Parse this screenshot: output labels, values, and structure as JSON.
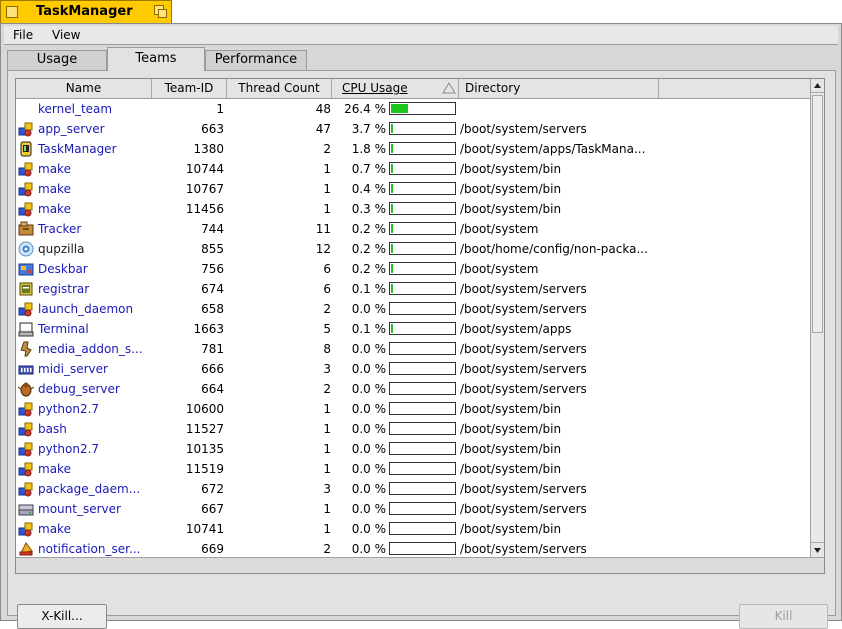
{
  "window": {
    "title": "TaskManager"
  },
  "menu": [
    "File",
    "View"
  ],
  "tabs": [
    {
      "label": "Usage",
      "active": false
    },
    {
      "label": "Teams",
      "active": true
    },
    {
      "label": "Performance",
      "active": false
    }
  ],
  "columns": {
    "name": "Name",
    "team_id": "Team-ID",
    "thread_count": "Thread Count",
    "cpu_usage": "CPU Usage",
    "directory": "Directory"
  },
  "sort": {
    "column": "cpu_usage",
    "direction": "descending"
  },
  "colors": {
    "title_tab": "#ffcb00",
    "cpu_bar": "#1fc41f",
    "link_text": "#1a1ab8"
  },
  "rows": [
    {
      "icon": "none",
      "name": "kernel_team",
      "team_id": "1",
      "threads": "48",
      "cpu": "26.4 %",
      "cpu_fraction": 0.264,
      "dir": ""
    },
    {
      "icon": "app-generic-icon",
      "name": "app_server",
      "team_id": "663",
      "threads": "47",
      "cpu": "3.7 %",
      "cpu_fraction": 0.037,
      "dir": "/boot/system/servers"
    },
    {
      "icon": "taskmanager-icon",
      "name": "TaskManager",
      "team_id": "1380",
      "threads": "2",
      "cpu": "1.8 %",
      "cpu_fraction": 0.018,
      "dir": "/boot/system/apps/TaskMana..."
    },
    {
      "icon": "app-generic-icon",
      "name": "make",
      "team_id": "10744",
      "threads": "1",
      "cpu": "0.7 %",
      "cpu_fraction": 0.007,
      "dir": "/boot/system/bin"
    },
    {
      "icon": "app-generic-icon",
      "name": "make",
      "team_id": "10767",
      "threads": "1",
      "cpu": "0.4 %",
      "cpu_fraction": 0.004,
      "dir": "/boot/system/bin"
    },
    {
      "icon": "app-generic-icon",
      "name": "make",
      "team_id": "11456",
      "threads": "1",
      "cpu": "0.3 %",
      "cpu_fraction": 0.003,
      "dir": "/boot/system/bin"
    },
    {
      "icon": "tracker-icon",
      "name": "Tracker",
      "team_id": "744",
      "threads": "11",
      "cpu": "0.2 %",
      "cpu_fraction": 0.002,
      "dir": "/boot/system"
    },
    {
      "icon": "qupzilla-icon",
      "name": "qupzilla",
      "team_id": "855",
      "threads": "12",
      "cpu": "0.2 %",
      "cpu_fraction": 0.002,
      "dir": "/boot/home/config/non-packa..."
    },
    {
      "icon": "deskbar-icon",
      "name": "Deskbar",
      "team_id": "756",
      "threads": "6",
      "cpu": "0.2 %",
      "cpu_fraction": 0.002,
      "dir": "/boot/system"
    },
    {
      "icon": "registrar-icon",
      "name": "registrar",
      "team_id": "674",
      "threads": "6",
      "cpu": "0.1 %",
      "cpu_fraction": 0.001,
      "dir": "/boot/system/servers"
    },
    {
      "icon": "app-generic-icon",
      "name": "launch_daemon",
      "team_id": "658",
      "threads": "2",
      "cpu": "0.0 %",
      "cpu_fraction": 0.0,
      "dir": "/boot/system/servers"
    },
    {
      "icon": "terminal-icon",
      "name": "Terminal",
      "team_id": "1663",
      "threads": "5",
      "cpu": "0.1 %",
      "cpu_fraction": 0.001,
      "dir": "/boot/system/apps"
    },
    {
      "icon": "media-addon-icon",
      "name": "media_addon_s...",
      "team_id": "781",
      "threads": "8",
      "cpu": "0.0 %",
      "cpu_fraction": 0.0,
      "dir": "/boot/system/servers"
    },
    {
      "icon": "midi-server-icon",
      "name": "midi_server",
      "team_id": "666",
      "threads": "3",
      "cpu": "0.0 %",
      "cpu_fraction": 0.0,
      "dir": "/boot/system/servers"
    },
    {
      "icon": "debug-server-icon",
      "name": "debug_server",
      "team_id": "664",
      "threads": "2",
      "cpu": "0.0 %",
      "cpu_fraction": 0.0,
      "dir": "/boot/system/servers"
    },
    {
      "icon": "app-generic-icon",
      "name": "python2.7",
      "team_id": "10600",
      "threads": "1",
      "cpu": "0.0 %",
      "cpu_fraction": 0.0,
      "dir": "/boot/system/bin"
    },
    {
      "icon": "app-generic-icon",
      "name": "bash",
      "team_id": "11527",
      "threads": "1",
      "cpu": "0.0 %",
      "cpu_fraction": 0.0,
      "dir": "/boot/system/bin"
    },
    {
      "icon": "app-generic-icon",
      "name": "python2.7",
      "team_id": "10135",
      "threads": "1",
      "cpu": "0.0 %",
      "cpu_fraction": 0.0,
      "dir": "/boot/system/bin"
    },
    {
      "icon": "app-generic-icon",
      "name": "make",
      "team_id": "11519",
      "threads": "1",
      "cpu": "0.0 %",
      "cpu_fraction": 0.0,
      "dir": "/boot/system/bin"
    },
    {
      "icon": "app-generic-icon",
      "name": "package_daem...",
      "team_id": "672",
      "threads": "3",
      "cpu": "0.0 %",
      "cpu_fraction": 0.0,
      "dir": "/boot/system/servers"
    },
    {
      "icon": "mount-server-icon",
      "name": "mount_server",
      "team_id": "667",
      "threads": "1",
      "cpu": "0.0 %",
      "cpu_fraction": 0.0,
      "dir": "/boot/system/servers"
    },
    {
      "icon": "app-generic-icon",
      "name": "make",
      "team_id": "10741",
      "threads": "1",
      "cpu": "0.0 %",
      "cpu_fraction": 0.0,
      "dir": "/boot/system/bin"
    },
    {
      "icon": "notification-server-icon",
      "name": "notification_ser...",
      "team_id": "669",
      "threads": "2",
      "cpu": "0.0 %",
      "cpu_fraction": 0.0,
      "dir": "/boot/system/servers"
    }
  ],
  "buttons": {
    "xkill": {
      "label": "X-Kill...",
      "enabled": true
    },
    "kill": {
      "label": "Kill",
      "enabled": false
    }
  }
}
